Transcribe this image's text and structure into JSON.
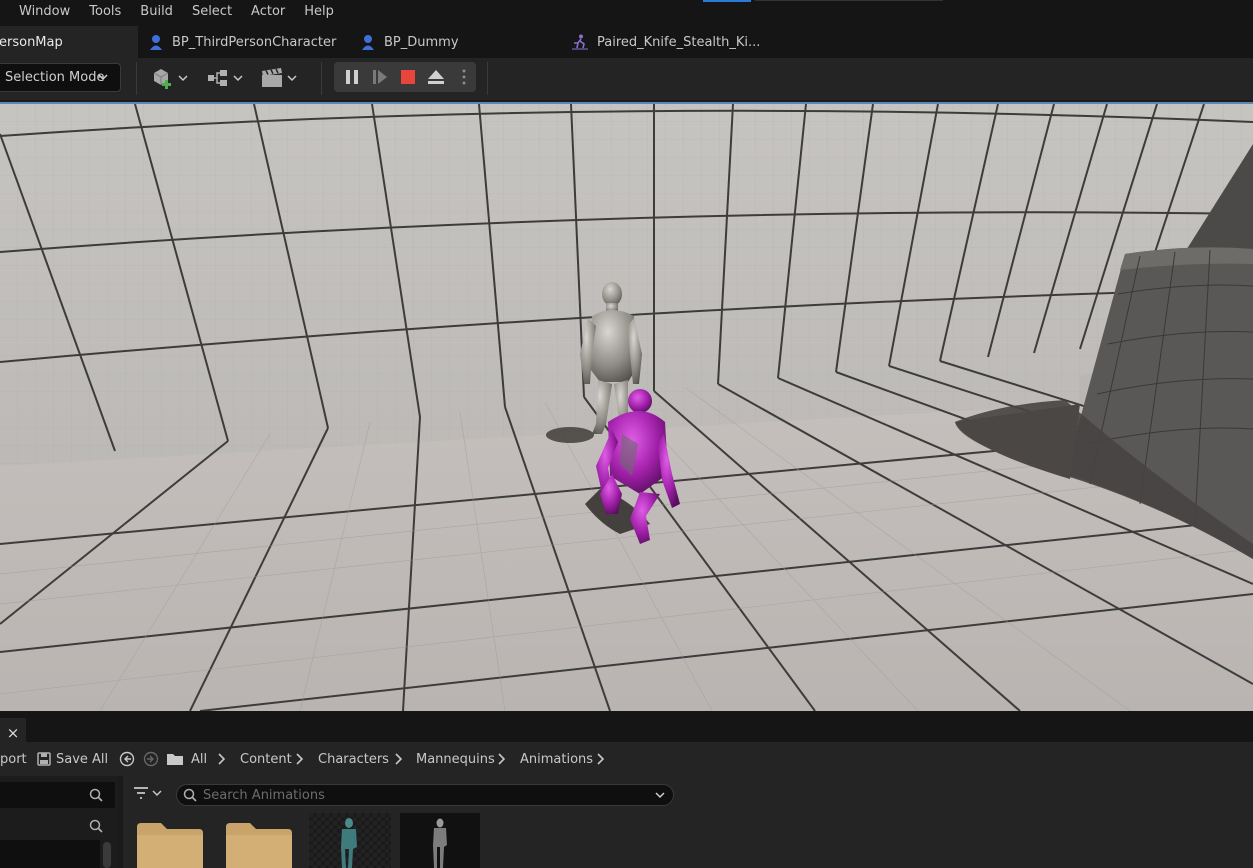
{
  "menu": [
    "Window",
    "Tools",
    "Build",
    "Select",
    "Actor",
    "Help"
  ],
  "tabs": [
    {
      "label": "ersonMap",
      "icon": "level-icon"
    },
    {
      "label": "BP_ThirdPersonCharacter",
      "icon": "blueprint-character-icon"
    },
    {
      "label": "BP_Dummy",
      "icon": "blueprint-character-icon"
    },
    {
      "label": "Paired_Knife_Stealth_Ki...",
      "icon": "animation-sequence-icon"
    }
  ],
  "toolbar": {
    "selection_mode": "Selection Mode",
    "icons": [
      "add-actor-icon",
      "blueprint-icon",
      "cinematics-icon"
    ],
    "play_controls": [
      "pause-icon",
      "step-frame-icon",
      "stop-icon",
      "eject-icon",
      "more-options-icon"
    ]
  },
  "content_browser": {
    "tab_close": "×",
    "import_label": "port",
    "save_all_label": "Save All",
    "breadcrumbs": [
      "All",
      "Content",
      "Characters",
      "Mannequins",
      "Animations"
    ],
    "search_placeholder": "Search Animations"
  },
  "colors": {
    "accent": "#5a88b8",
    "stop": "#e8453c",
    "folder": "#c8a36a",
    "character_highlight": "#a020a8"
  }
}
